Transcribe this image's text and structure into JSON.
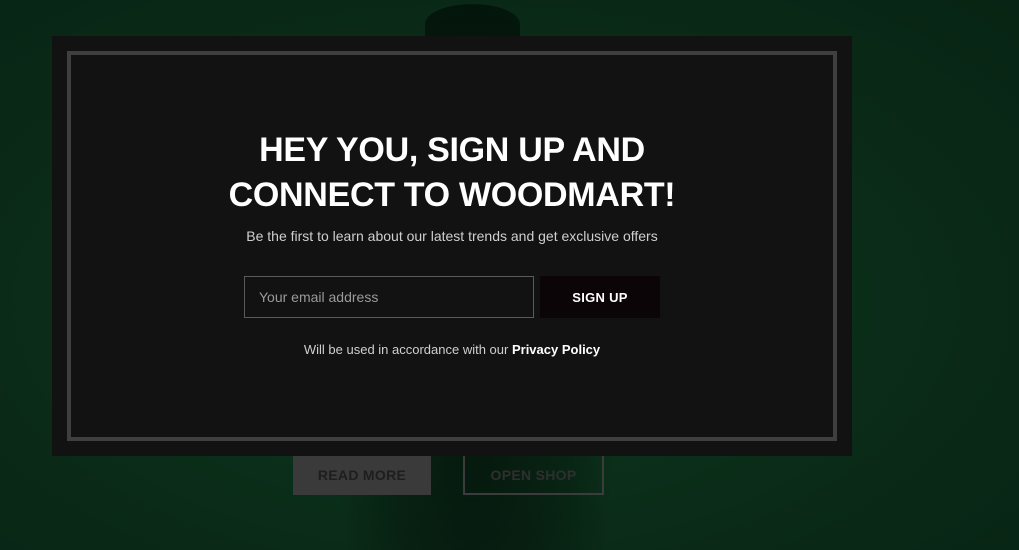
{
  "background": {
    "read_more_label": "READ MORE",
    "open_shop_label": "OPEN SHOP"
  },
  "popup": {
    "headline_line1": "HEY YOU, SIGN UP AND",
    "headline_line2": "CONNECT TO WOODMART!",
    "subline": "Be the first to learn about our latest trends and get exclusive offers",
    "email_placeholder": "Your email address",
    "signup_label": "SIGN UP",
    "privacy_text": "Will be used in accordance with our",
    "privacy_link": "Privacy Policy"
  },
  "colors": {
    "backdrop": "#0a2a18",
    "popup_bg": "#121212",
    "frame": "#3f3f3f",
    "button_bg": "#0b0507"
  }
}
